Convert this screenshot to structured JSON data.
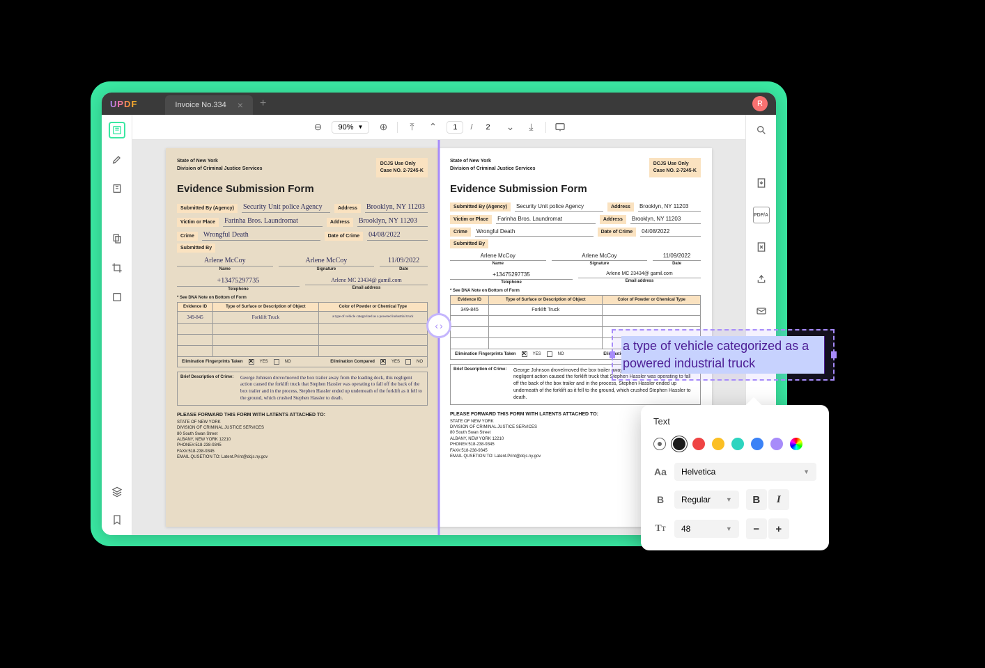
{
  "app": {
    "logo": "UPDF",
    "tab_title": "Invoice No.334",
    "avatar_initial": "R"
  },
  "toolbar": {
    "zoom": "90%",
    "page_current": "1",
    "page_total": "2"
  },
  "form": {
    "state_line1": "State of New York",
    "state_line2": "Division of Criminal Justice Services",
    "dcjs_line1": "DCJS Use Only",
    "dcjs_line2": "Case NO. 2-7245-K",
    "title": "Evidence Submission Form",
    "labels": {
      "submitted_by_agency": "Submitted By (Agency)",
      "address": "Address",
      "victim_or_place": "Victim or Place",
      "crime": "Crime",
      "date_of_crime": "Date of Crime",
      "submitted_by": "Submitted By",
      "name": "Name",
      "signature": "Signature",
      "date": "Date",
      "telephone": "Telephone",
      "email": "Email address",
      "dna_note": "* See DNA Note on Bottom of Form",
      "evidence_id": "Evidence ID",
      "surface": "Type of Surface or Description of Object",
      "powder": "Color of Powder or Chemical Type",
      "elim_taken": "Elimination Fingerprints Taken",
      "elim_compared": "Elimination Compared",
      "yes": "YES",
      "no": "NO",
      "brief_desc": "Brief Description of Crime:",
      "forward": "PLEASE FORWARD THIS FORM WITH LATENTS ATTACHED TO:"
    },
    "values": {
      "agency": "Security Unit police Agency",
      "address1": "Brooklyn, NY 11203",
      "victim": "Farinha Bros. Laundromat",
      "address2": "Brooklyn, NY 11203",
      "crime": "Wrongful Death",
      "date_crime": "04/08/2022",
      "name": "Arlene McCoy",
      "signature": "Arlene McCoy",
      "date": "11/09/2022",
      "telephone": "+13475297735",
      "email": "Arlene MC 23434@ gamil.com",
      "evidence_id": "349-845",
      "surface": "Forklift Truck",
      "powder_scanned": "a type of vehicle categorized as a powered industrial truck",
      "description": "George Johnson drove/moved the box trailer away from the loading dock, this negligent action caused the forklift truck that Stephen Hassler was operating to fall off the back of the box trailer and in the process, Stephen Hassler ended up underneath of the forklift as it fell to the ground, which crushed Stephen Hassler to death."
    },
    "address_block": {
      "l1": "STATE OF NEW YORK",
      "l2": "DIVISION OF CRIMINAL JUSTICE SERVICES",
      "l3": "80 South Swan Street",
      "l4": "ALBANY, NEW YORK 12210",
      "l5": "PHONE#:518-238-9345",
      "l6": "FAX#:518-238-9345",
      "l7": "EMAIL QUSETION TO: Latent.Print@dcjs.ny.gov"
    }
  },
  "edited_text": "a type of vehicle categorized as a powered industrial truck",
  "text_panel": {
    "title": "Text",
    "colors": [
      "#1a1a1a",
      "#ef4444",
      "#fbbf24",
      "#2dd4bf",
      "#3b82f6",
      "#a78bfa"
    ],
    "font": "Helvetica",
    "weight": "Regular",
    "size": "48"
  }
}
